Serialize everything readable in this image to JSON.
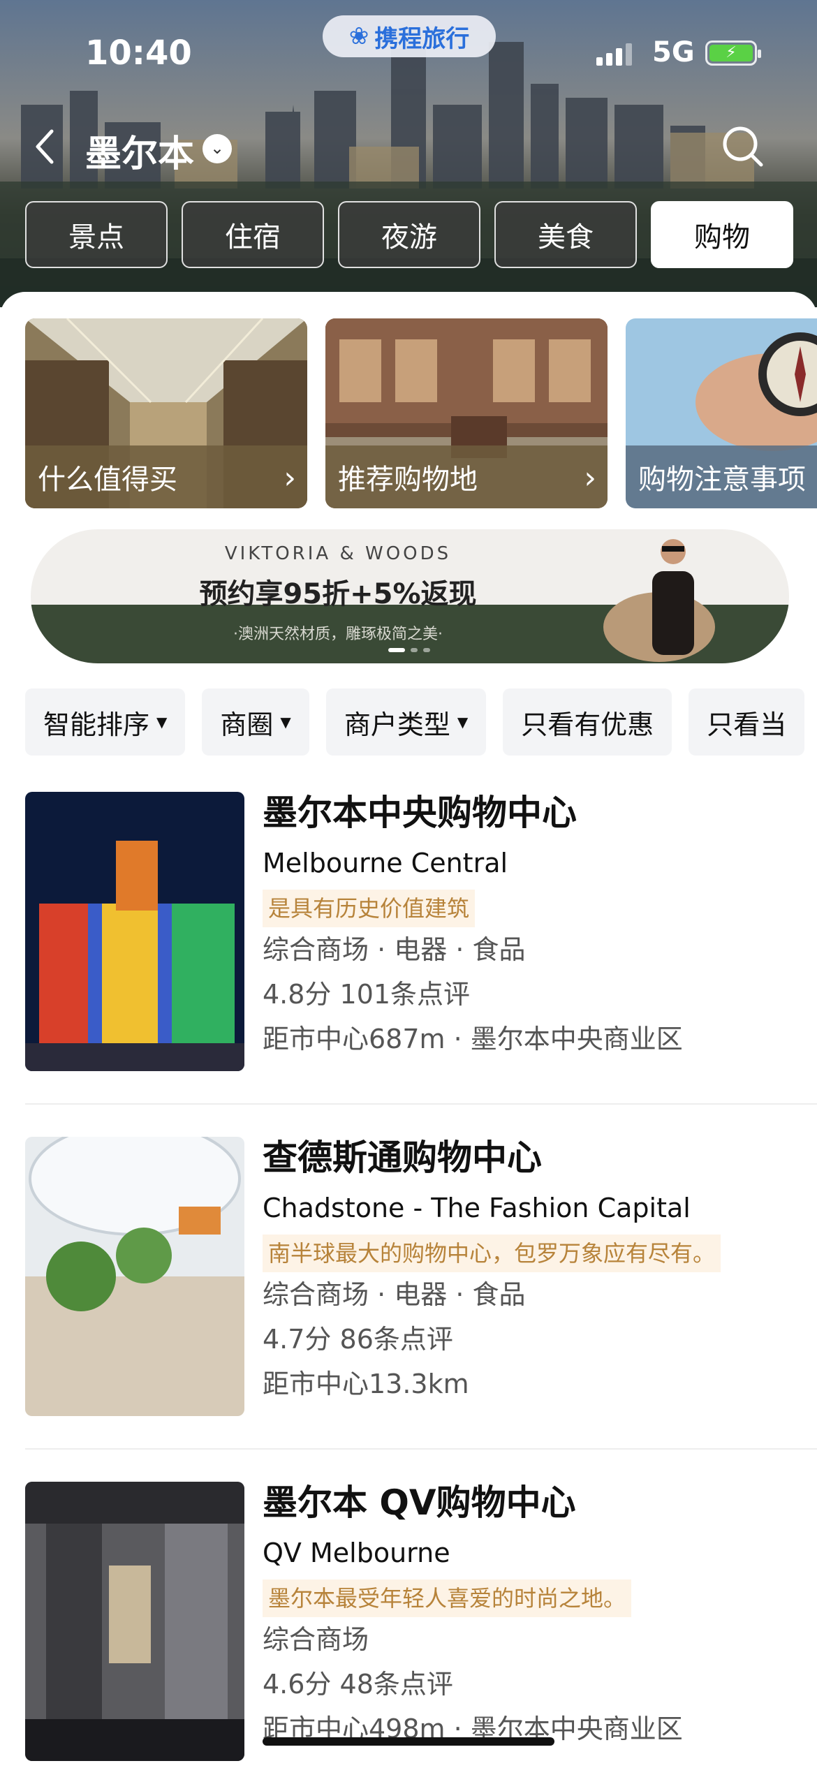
{
  "status_bar": {
    "time": "10:40",
    "network": "5G",
    "brand": "携程旅行"
  },
  "header": {
    "city": "墨尔本",
    "back_icon": "chevron-left-icon",
    "search_icon": "search-icon"
  },
  "category_tabs": [
    {
      "label": "景点",
      "active": false
    },
    {
      "label": "住宿",
      "active": false
    },
    {
      "label": "夜游",
      "active": false
    },
    {
      "label": "美食",
      "active": false
    },
    {
      "label": "购物",
      "active": true
    }
  ],
  "feature_cards": [
    {
      "label": "什么值得买",
      "has_chevron": true
    },
    {
      "label": "推荐购物地",
      "has_chevron": true
    },
    {
      "label": "购物注意事项",
      "has_chevron": false
    }
  ],
  "banner": {
    "brand": "VIKTORIA & WOODS",
    "headline": "预约享95折+5%返现",
    "subline": "·澳洲天然材质，雕琢极简之美·"
  },
  "filters": [
    {
      "label": "智能排序",
      "dropdown": true
    },
    {
      "label": "商圈",
      "dropdown": true
    },
    {
      "label": "商户类型",
      "dropdown": true
    },
    {
      "label": "只看有优惠",
      "dropdown": false
    },
    {
      "label": "只看当",
      "dropdown": false
    }
  ],
  "listings": [
    {
      "name_cn": "墨尔本中央购物中心",
      "name_en": "Melbourne Central",
      "tagline": "是具有历史价值建筑",
      "categories": "综合商场 · 电器 · 食品",
      "rating": "4.8分 101条点评",
      "distance": "距市中心687m · 墨尔本中央商业区"
    },
    {
      "name_cn": "查德斯通购物中心",
      "name_en": "Chadstone - The Fashion Capital",
      "tagline": "南半球最大的购物中心，包罗万象应有尽有。",
      "categories": "综合商场 · 电器 · 食品",
      "rating": "4.7分 86条点评",
      "distance": "距市中心13.3km"
    },
    {
      "name_cn": "墨尔本 QV购物中心",
      "name_en": "QV Melbourne",
      "tagline": "墨尔本最受年轻人喜爱的时尚之地。",
      "categories": "综合商场",
      "rating": "4.6分 48条点评",
      "distance": "距市中心498m · 墨尔本中央商业区"
    }
  ],
  "colors": {
    "accent": "#2a6fdb",
    "tag_bg": "#fdf3e6",
    "tag_text": "#b7833a",
    "battery": "#5ad145"
  }
}
